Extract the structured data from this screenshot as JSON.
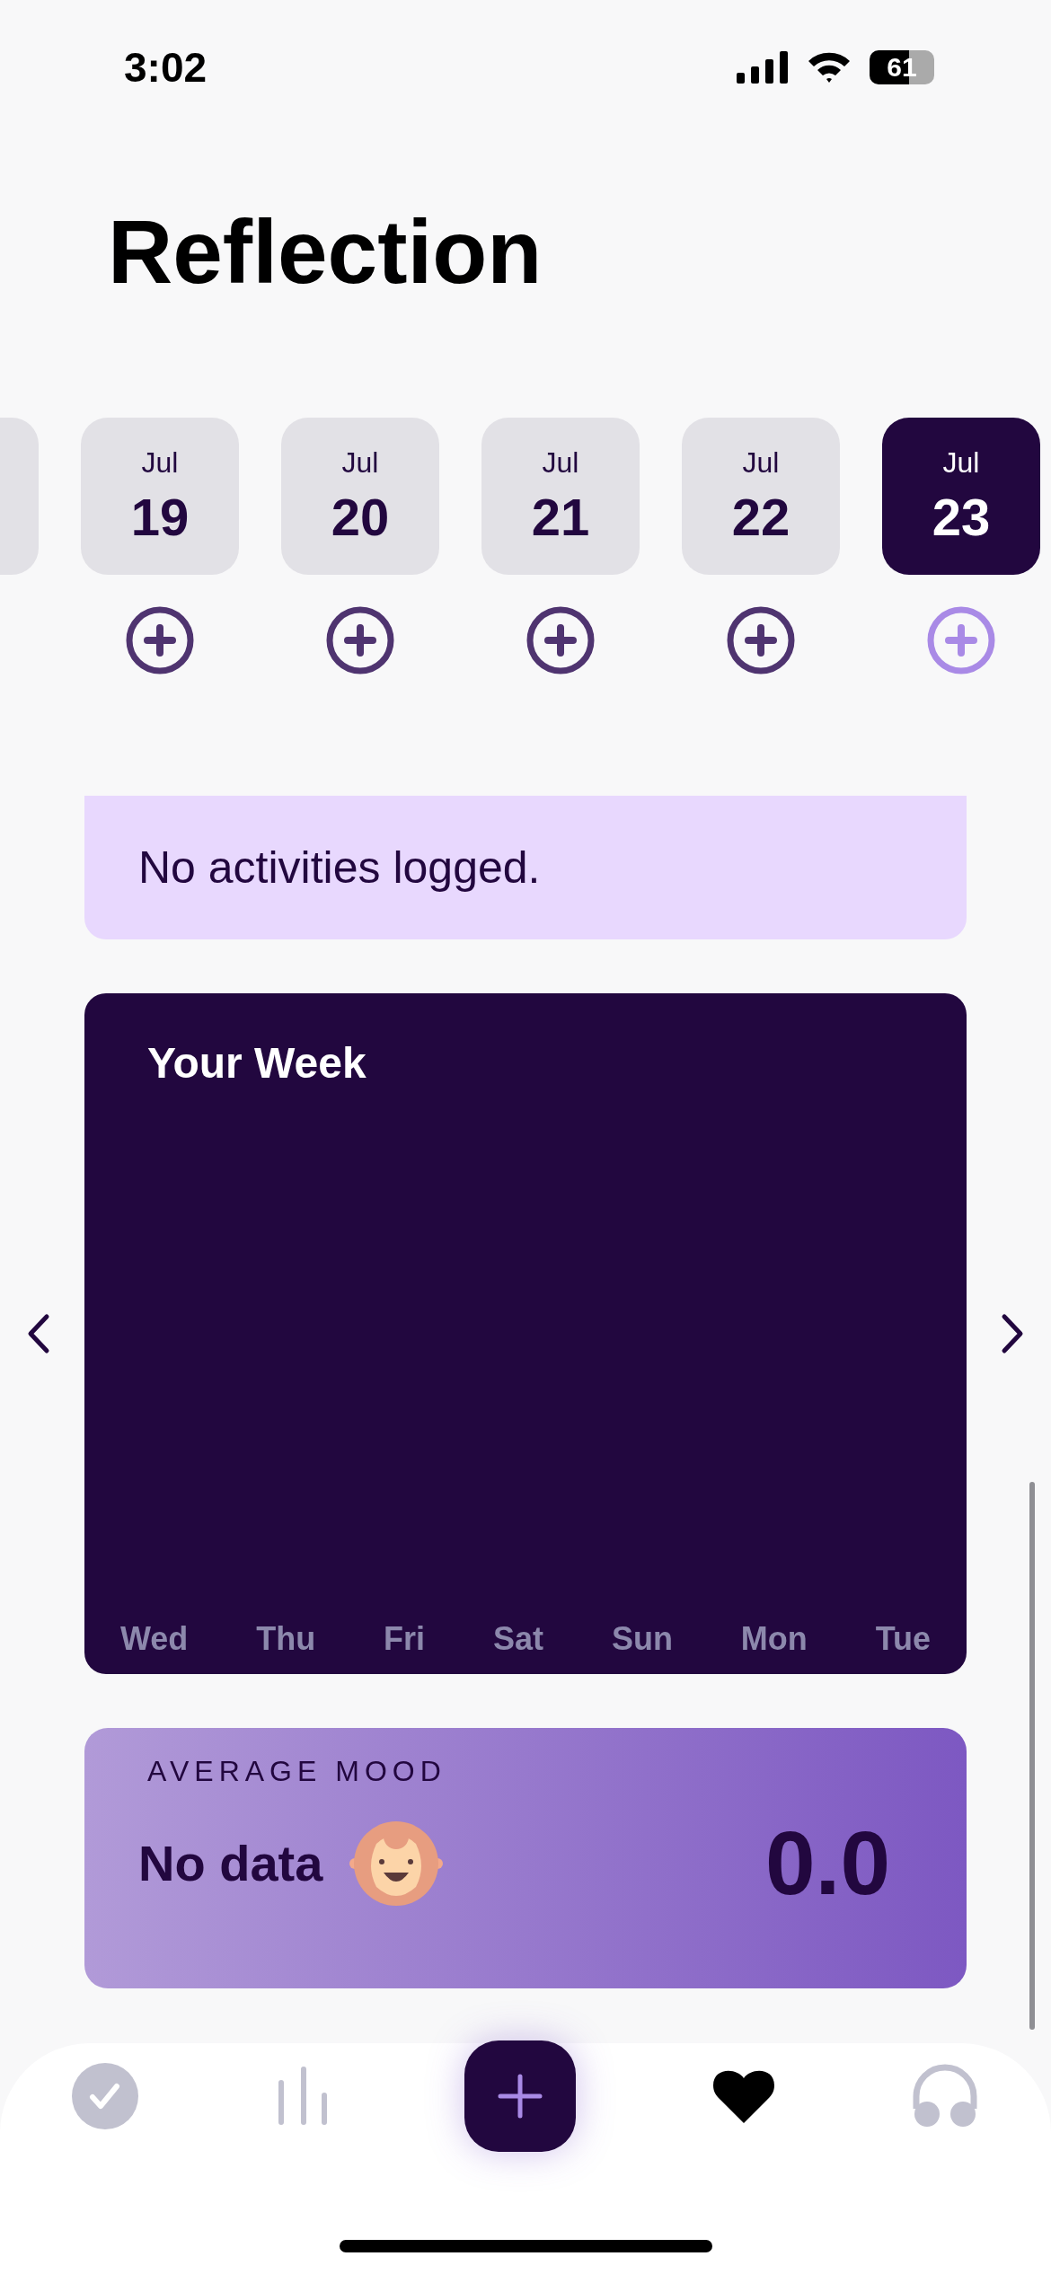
{
  "status_bar": {
    "time": "3:02",
    "battery": "61"
  },
  "title": "Reflection",
  "dates": [
    {
      "month": "Jul",
      "day": "19",
      "selected": false
    },
    {
      "month": "Jul",
      "day": "20",
      "selected": false
    },
    {
      "month": "Jul",
      "day": "21",
      "selected": false
    },
    {
      "month": "Jul",
      "day": "22",
      "selected": false
    },
    {
      "month": "Jul",
      "day": "23",
      "selected": true
    }
  ],
  "activities": {
    "message": "No activities logged."
  },
  "week": {
    "title": "Your Week",
    "days": [
      "Wed",
      "Thu",
      "Fri",
      "Sat",
      "Sun",
      "Mon",
      "Tue"
    ]
  },
  "mood": {
    "label": "AVERAGE MOOD",
    "status": "No data",
    "value": "0.0"
  },
  "nav": [
    {
      "kind": "check",
      "selected": false
    },
    {
      "kind": "stats",
      "selected": false
    },
    {
      "kind": "add",
      "selected": false
    },
    {
      "kind": "heart",
      "selected": true
    },
    {
      "kind": "headphones",
      "selected": false
    }
  ]
}
